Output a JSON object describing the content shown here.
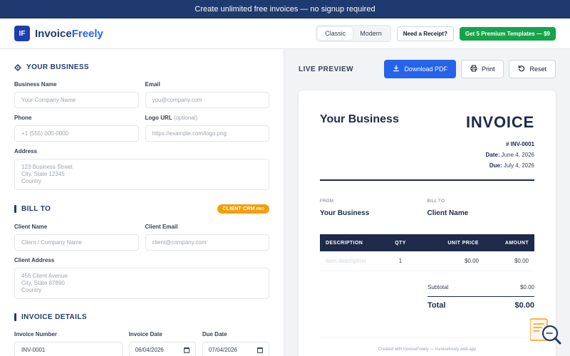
{
  "banner": {
    "text": "Create unlimited free invoices — no signup required"
  },
  "header": {
    "logo_mark": "IF",
    "logo_part1": "Invoice",
    "logo_part2": "Freely",
    "template_tabs": [
      "Classic",
      "Modern"
    ],
    "active_tab": "Classic",
    "receipt_button": "Need a Receipt?",
    "premium_button": "Get 5 Premium Templates — $9"
  },
  "business": {
    "heading": "YOUR BUSINESS",
    "name_label": "Business Name",
    "name_placeholder": "Your Company Name",
    "email_label": "Email",
    "email_placeholder": "you@company.com",
    "phone_label": "Phone",
    "phone_placeholder": "+1 (555) 000-0000",
    "logo_label": "Logo URL",
    "logo_optional": "(optional)",
    "logo_placeholder": "https://example.com/logo.png",
    "address_label": "Address",
    "address_placeholder": "123 Business Street\nCity, State 12345\nCountry"
  },
  "bill_to": {
    "heading": "BILL TO",
    "crm_badge": "CLIENT CRM",
    "crm_badge_pro": "PRO",
    "client_name_label": "Client Name",
    "client_name_placeholder": "Client / Company Name",
    "client_email_label": "Client Email",
    "client_email_placeholder": "client@company.com",
    "client_address_label": "Client Address",
    "client_address_placeholder": "456 Client Avenue\nCity, State 67890\nCountry"
  },
  "invoice_details": {
    "heading": "INVOICE DETAILS",
    "number_label": "Invoice Number",
    "number_value": "INV-0001",
    "date_label": "Invoice Date",
    "date_value": "06/04/2026",
    "due_label": "Due Date",
    "due_value": "07/04/2026"
  },
  "preview": {
    "title": "LIVE PREVIEW",
    "download_button": "Download PDF",
    "print_button": "Print",
    "reset_button": "Reset"
  },
  "invoice": {
    "business_name": "Your Business",
    "title": "INVOICE",
    "number": "# INV-0001",
    "date_label": "Date:",
    "date": "June 4, 2026",
    "due_label": "Due:",
    "due": "July 4, 2026",
    "from_label": "FROM",
    "from_name": "Your Business",
    "bill_to_label": "BILL TO",
    "bill_to_name": "Client Name",
    "columns": [
      "DESCRIPTION",
      "QTY",
      "UNIT PRICE",
      "AMOUNT"
    ],
    "items": [
      {
        "description": "Item description",
        "qty": "1",
        "unit_price": "$0.00",
        "amount": "$0.00"
      }
    ],
    "subtotal_label": "Subtotal",
    "subtotal": "$0.00",
    "total_label": "Total",
    "total": "$0.00",
    "footer": "Created with InvoiceFreely — invoicefreely.web.app"
  },
  "colors": {
    "navy": "#1e2a4a",
    "brand": "#1e40af",
    "primary": "#2563eb",
    "success": "#16a34a",
    "badge": "#f59e0b"
  },
  "icons": [
    "gear-icon",
    "bar-icon",
    "download-icon",
    "print-icon",
    "reset-icon",
    "search-invoice-icon",
    "calendar-icon"
  ]
}
